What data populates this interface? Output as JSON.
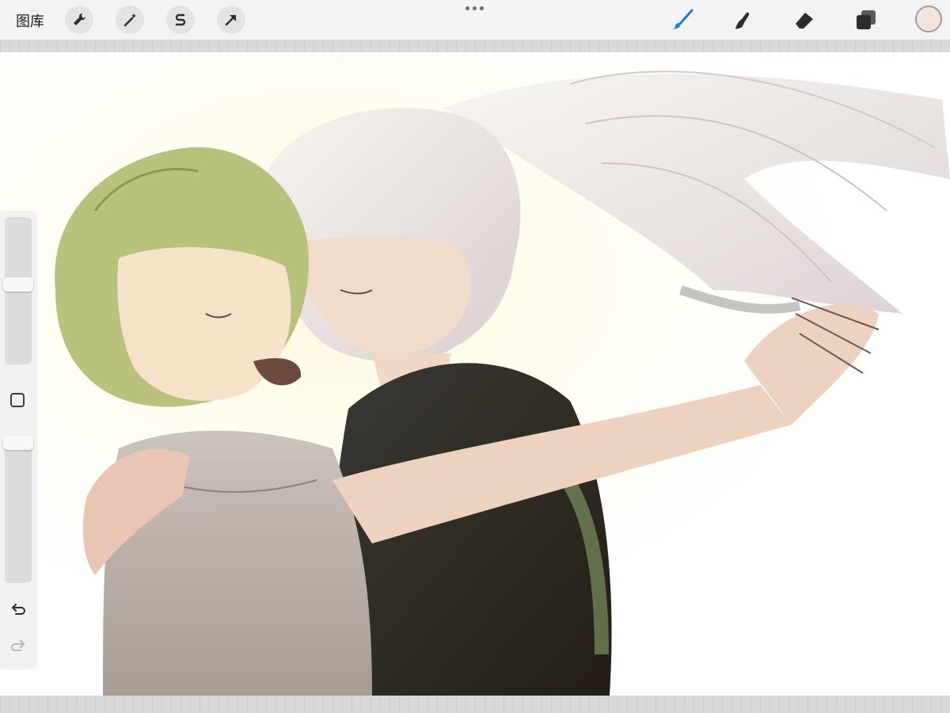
{
  "toolbar": {
    "gallery_label": "图库",
    "left_tools": [
      "wrench-icon",
      "magic-wand-icon",
      "selection-s-icon",
      "transform-arrow-icon"
    ],
    "right_tools": [
      "brush-icon",
      "smudge-icon",
      "eraser-icon",
      "layers-icon",
      "color-swatch"
    ],
    "active_tool": "brush-icon",
    "accent_color": "#1f7ae0",
    "current_color": "#f3e4de"
  },
  "sidebar": {
    "brush_size_level": 0.55,
    "opacity_level": 1.0,
    "buttons": [
      "modify-square-icon",
      "undo-icon",
      "redo-icon"
    ]
  },
  "canvas": {
    "content": "illustration"
  }
}
